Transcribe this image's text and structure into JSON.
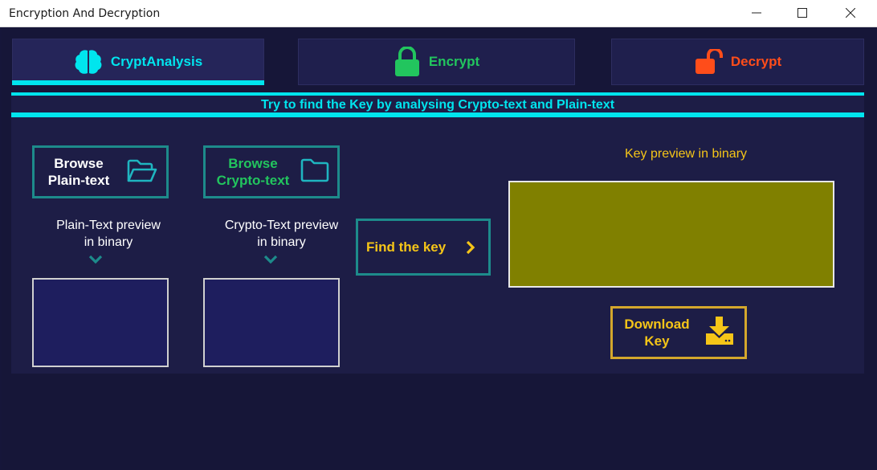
{
  "window": {
    "title": "Encryption And Decryption"
  },
  "tabs": {
    "cryptanalysis": {
      "label": "CryptAnalysis",
      "icon": "brain-icon",
      "color": "#00e5ee",
      "active": true
    },
    "encrypt": {
      "label": "Encrypt",
      "icon": "lock-icon",
      "color": "#22c55e"
    },
    "decrypt": {
      "label": "Decrypt",
      "icon": "unlock-icon",
      "color": "#ff4d1a"
    }
  },
  "banner": {
    "text": "Try to find the Key by analysing Crypto-text and Plain-text"
  },
  "plain": {
    "button_line1": "Browse",
    "button_line2": "Plain-text",
    "preview_line1": "Plain-Text preview",
    "preview_line2": "in binary"
  },
  "crypto": {
    "button_line1": "Browse",
    "button_line2": "Crypto-text",
    "preview_line1": "Crypto-Text preview",
    "preview_line2": "in binary"
  },
  "find_key": {
    "label": "Find the key"
  },
  "key": {
    "preview_label": "Key preview in binary",
    "download_line1": "Download",
    "download_line2": "Key"
  },
  "colors": {
    "accent": "#00e5ee",
    "green": "#22c55e",
    "orange": "#ff4d1a",
    "yellow": "#f5c518",
    "key_box": "#808000"
  }
}
